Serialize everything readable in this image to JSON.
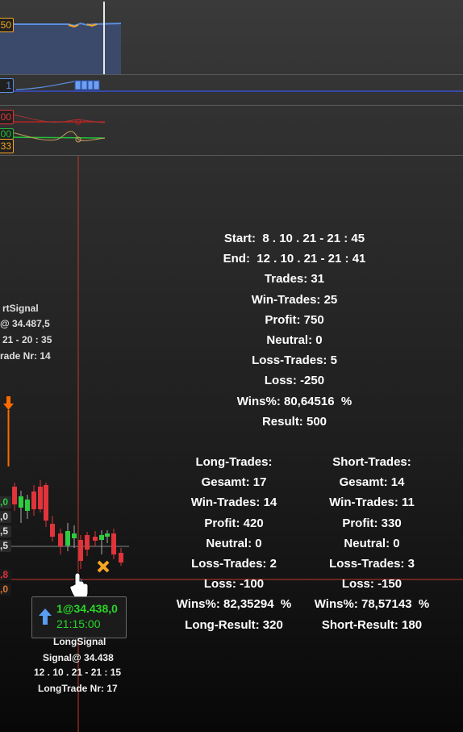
{
  "axis_labels": {
    "pane1": "50",
    "pane2": "1",
    "pane3_top": "00",
    "pane3_mid": "00",
    "pane3_bot": "33"
  },
  "price_scale": [
    ",0",
    ",0",
    ",5",
    ",5",
    ",8",
    ",0"
  ],
  "short_signal": {
    "line1": "rtSignal",
    "line2": "@ 34.487,5",
    "line3": "21 - 20 : 35",
    "line4": "rade Nr: 14"
  },
  "long_signal": {
    "tooltip_price": "1@34.438,0",
    "tooltip_time": "21:15:00",
    "line1": "LongSignal",
    "line2": "Signal@ 34.438",
    "line3": "12 . 10 . 21 - 21 : 15",
    "line4": "LongTrade Nr: 17"
  },
  "summary": {
    "start": "Start:  8 . 10 . 21 - 21 : 45",
    "end": "End:  12 . 10 . 21 - 21 : 41",
    "trades": "Trades: 31",
    "win_trades": "Win-Trades: 25",
    "profit": "Profit: 750",
    "neutral": "Neutral: 0",
    "loss_trades": "Loss-Trades: 5",
    "loss": "Loss: -250",
    "wins_pct": "Wins%: 80,64516  %",
    "result": "Result: 500"
  },
  "long": {
    "header": "Long-Trades:",
    "gesamt": "Gesamt: 17",
    "win_trades": "Win-Trades: 14",
    "profit": "Profit: 420",
    "neutral": "Neutral: 0",
    "loss_trades": "Loss-Trades: 2",
    "loss": "Loss: -100",
    "wins_pct": "Wins%: 82,35294  %",
    "result": "Long-Result: 320"
  },
  "short": {
    "header": "Short-Trades:",
    "gesamt": "Gesamt: 14",
    "win_trades": "Win-Trades: 11",
    "profit": "Profit: 330",
    "neutral": "Neutral: 0",
    "loss_trades": "Loss-Trades: 3",
    "loss": "Loss: -150",
    "wins_pct": "Wins%: 78,57143  %",
    "result": "Short-Result: 180"
  },
  "colors": {
    "crosshair": "#c0392b",
    "win_candle": "#2ecc40",
    "loss_candle": "#e0343a",
    "long_arrow": "#5a9cf0",
    "short_arrow": "#ff6a00",
    "exit_marker": "#f5a623",
    "indicator_fill": "#3b4a6b"
  },
  "icons": {
    "long_arrow": "arrow-up-icon",
    "short_arrow": "arrow-down-icon",
    "exit": "x-marker-icon",
    "cursor": "hand-cursor-icon"
  }
}
